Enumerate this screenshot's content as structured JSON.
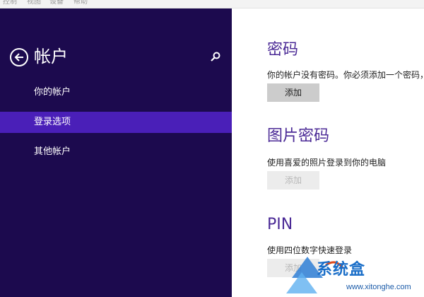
{
  "menubar": {
    "items": [
      "控制",
      "视图",
      "设备",
      "帮助"
    ]
  },
  "sidebar": {
    "title": "帐户",
    "back_icon": "back-arrow-icon",
    "search_icon": "search-icon",
    "items": [
      {
        "label": "你的帐户",
        "active": false
      },
      {
        "label": "登录选项",
        "active": true
      },
      {
        "label": "其他帐户",
        "active": false
      }
    ]
  },
  "main": {
    "sections": [
      {
        "title": "密码",
        "description": "你的帐户没有密码。你必须添加一个密码，",
        "button": "添加",
        "enabled": true
      },
      {
        "title": "图片密码",
        "description": "使用喜爱的照片登录到你的电脑",
        "button": "添加",
        "enabled": false
      },
      {
        "title": "PIN",
        "description": "使用四位数字快速登录",
        "button": "添加",
        "enabled": false
      }
    ]
  },
  "watermark": {
    "brand": "系统盒",
    "url": "www.xitonghe.com"
  },
  "colors": {
    "sidebar_bg": "#1c0a4e",
    "active_item_bg": "#4a1fb8",
    "section_title": "#4b2a96"
  }
}
